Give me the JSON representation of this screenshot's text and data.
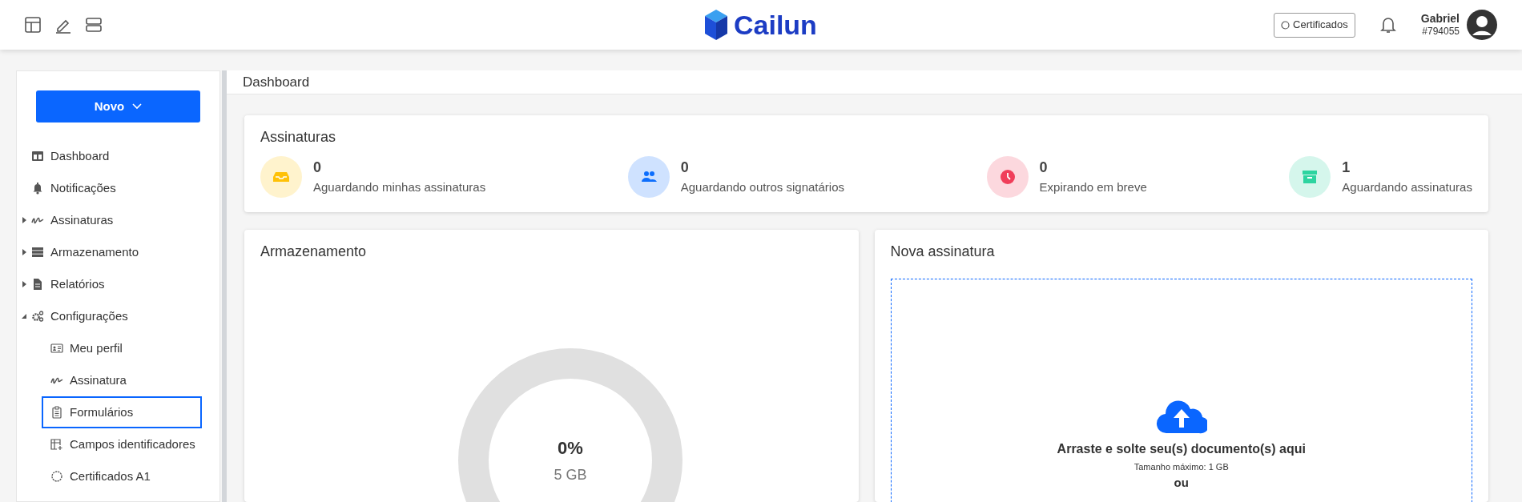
{
  "header": {
    "logo_text": "Cailun",
    "certificates_button": "Certificados",
    "user": {
      "name": "Gabriel",
      "id": "#794055"
    }
  },
  "sidebar": {
    "new_button": "Novo",
    "items": [
      {
        "label": "Dashboard",
        "selected": false
      },
      {
        "label": "Notificações",
        "selected": false
      },
      {
        "label": "Assinaturas",
        "selected": false,
        "expanded": false
      },
      {
        "label": "Armazenamento",
        "selected": false,
        "expanded": false
      },
      {
        "label": "Relatórios",
        "selected": false,
        "expanded": false
      },
      {
        "label": "Configurações",
        "selected": false,
        "expanded": true,
        "children": [
          {
            "label": "Meu perfil",
            "selected": false
          },
          {
            "label": "Assinatura",
            "selected": false
          },
          {
            "label": "Formulários",
            "selected": true
          },
          {
            "label": "Campos identificadores",
            "selected": false
          },
          {
            "label": "Certificados A1",
            "selected": false
          }
        ]
      }
    ]
  },
  "page_title": "Dashboard",
  "signatures": {
    "title": "Assinaturas",
    "stats": [
      {
        "count": "0",
        "label": "Aguardando minhas assinaturas",
        "color": "#ffc107"
      },
      {
        "count": "0",
        "label": "Aguardando outros signatários",
        "color": "#0d6efd"
      },
      {
        "count": "0",
        "label": "Expirando em breve",
        "color": "#f03e5a"
      },
      {
        "count": "1",
        "label": "Aguardando assinaturas",
        "color": "#2dd4a0"
      }
    ]
  },
  "storage": {
    "title": "Armazenamento",
    "percent": "0%",
    "total": "5 GB"
  },
  "new_signature": {
    "title": "Nova assinatura",
    "drop_text": "Arraste e solte seu(s) documento(s) aqui",
    "max_size": "Tamanho máximo: 1 GB",
    "or_text": "ou"
  }
}
